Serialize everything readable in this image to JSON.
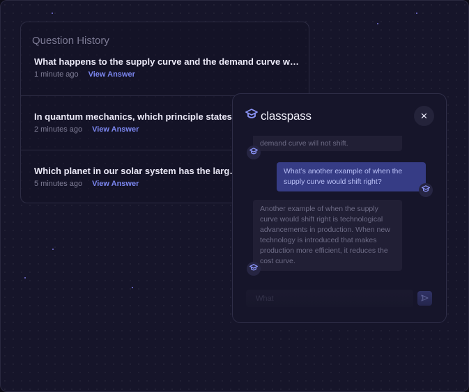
{
  "history": {
    "title": "Question History",
    "items": [
      {
        "question": "What happens to the supply curve and the demand curve whe...",
        "time": "1 minute ago",
        "link": "View Answer"
      },
      {
        "question": "In quantum mechanics, which principle states that",
        "time": "2 minutes ago",
        "link": "View Answer"
      },
      {
        "question": "Which planet in our solar system has the largest v",
        "time": "5 minutes ago",
        "link": "View Answer"
      }
    ]
  },
  "chat": {
    "brand": "classpass",
    "close_label": "×",
    "messages": [
      {
        "role": "bot",
        "text": "demand curve will not shift."
      },
      {
        "role": "user",
        "text": "What’s another example of when the supply curve would shift right?"
      },
      {
        "role": "bot",
        "text": "Another example of when the supply curve would shift right is technological advancements in production. When new technology is introduced that makes production more efficient, it reduces the cost curve."
      }
    ],
    "input_placeholder": "What",
    "icons": {
      "brand": "classpass-logo-icon",
      "avatar": "graduation-cap-icon",
      "send": "send-icon",
      "close": "close-icon"
    }
  },
  "colors": {
    "accent": "#7b86ef",
    "user_bubble": "#363c85",
    "background": "#16152a"
  }
}
